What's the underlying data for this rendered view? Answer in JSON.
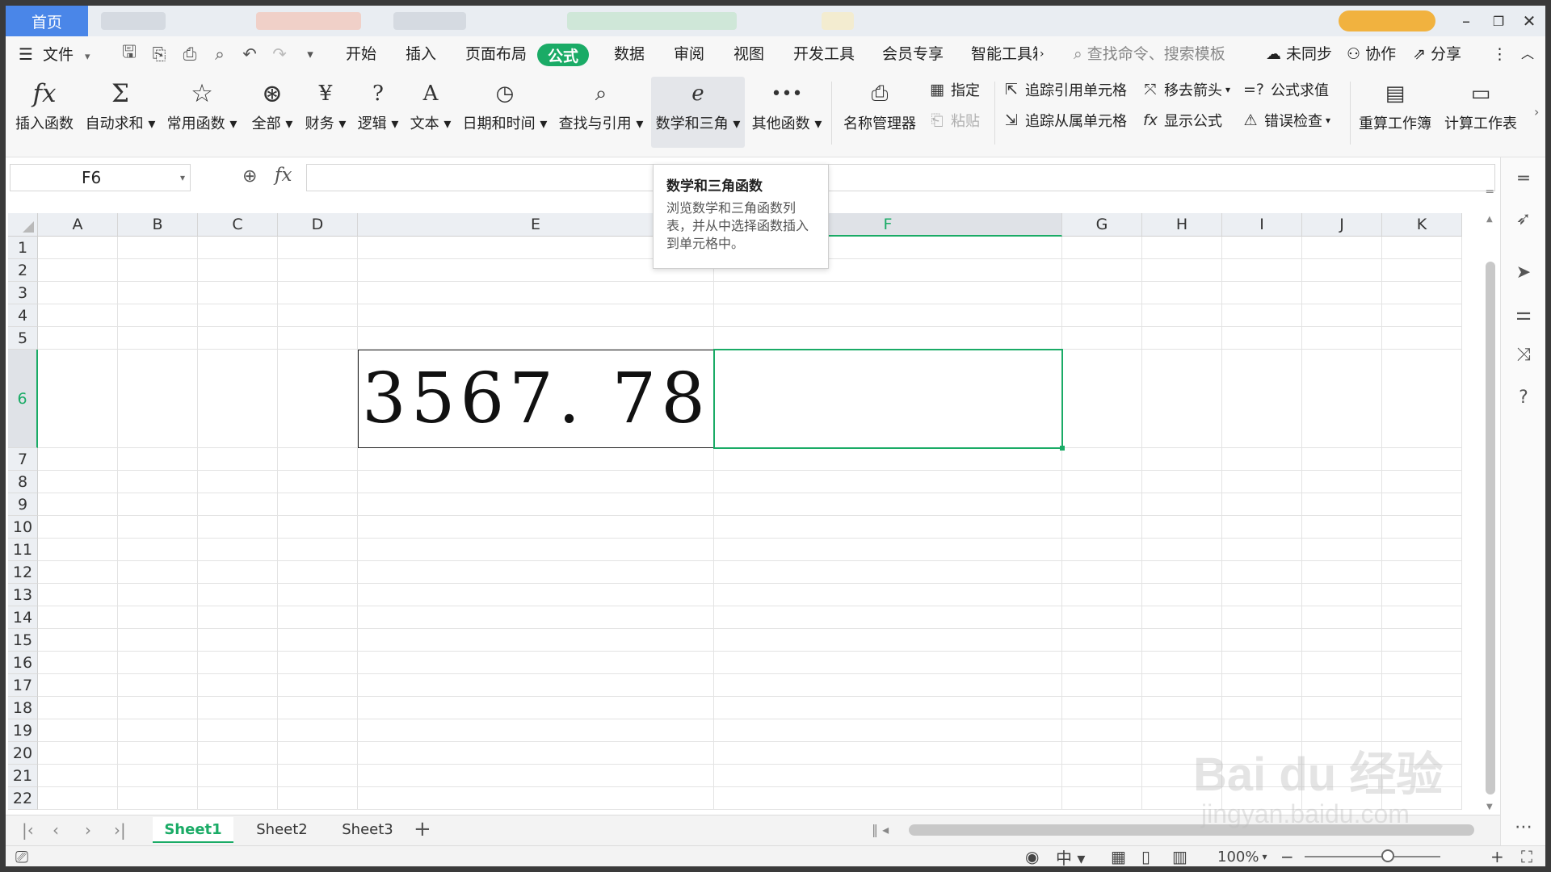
{
  "titlebar": {
    "home_tab": "首页"
  },
  "menu": {
    "file": "文件",
    "tabs": [
      "开始",
      "插入",
      "页面布局",
      "公式",
      "数据",
      "审阅",
      "视图",
      "开发工具",
      "会员专享",
      "智能工具箱"
    ],
    "active_tab": "公式",
    "search_placeholder": "查找命令、搜索模板",
    "sync": "未同步",
    "collab": "协作",
    "share": "分享"
  },
  "ribbon": {
    "insert_function": "插入函数",
    "autosum": "自动求和",
    "common": "常用函数",
    "all": "全部",
    "finance": "财务",
    "logic": "逻辑",
    "text": "文本",
    "datetime": "日期和时间",
    "lookup": "查找与引用",
    "math": "数学和三角",
    "other": "其他函数",
    "name_manager": "名称管理器",
    "specify": "指定",
    "paste": "粘贴",
    "trace_precedents": "追踪引用单元格",
    "trace_dependents": "追踪从属单元格",
    "remove_arrows": "移去箭头",
    "show_formulas": "显示公式",
    "evaluate": "公式求值",
    "error_check": "错误检查",
    "recalc_workbook": "重算工作簿",
    "calc_sheet": "计算工作表"
  },
  "formula_bar": {
    "name_box": "F6",
    "fx": "fx",
    "value": ""
  },
  "tooltip": {
    "title": "数学和三角函数",
    "description": "浏览数学和三角函数列表，并从中选择函数插入到单元格中。"
  },
  "grid": {
    "columns": [
      "A",
      "B",
      "C",
      "D",
      "E",
      "F",
      "G",
      "H",
      "I",
      "J",
      "K"
    ],
    "rows": [
      "1",
      "2",
      "3",
      "4",
      "5",
      "6",
      "7",
      "8",
      "9",
      "10",
      "11",
      "12",
      "13",
      "14",
      "15",
      "16",
      "17",
      "18",
      "19",
      "20",
      "21",
      "22"
    ],
    "selected_cell": "F6",
    "cells": {
      "E6": "3567. 78"
    }
  },
  "sheets": {
    "tabs": [
      "Sheet1",
      "Sheet2",
      "Sheet3"
    ],
    "active": "Sheet1"
  },
  "status": {
    "zoom": "100%"
  },
  "watermark": {
    "text": "Bai du 经验",
    "sub": "jingyan.baidu.com"
  },
  "colors": {
    "accent": "#1aab66",
    "home_tab": "#4a86e8"
  }
}
